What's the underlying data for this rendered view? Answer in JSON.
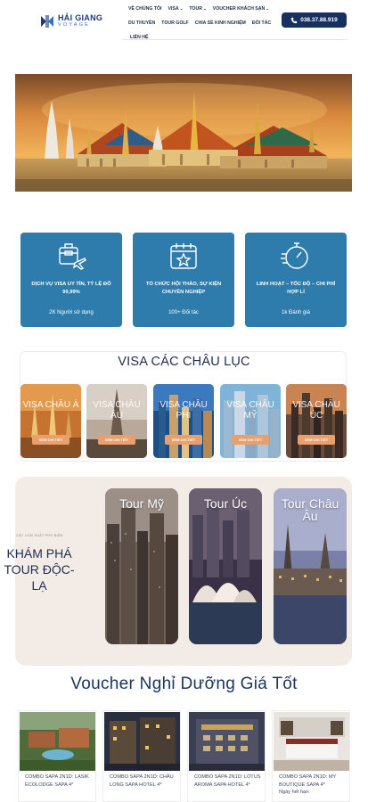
{
  "brand": {
    "name": "HẢI GIANG",
    "sub": "VOYAGE"
  },
  "nav": {
    "row1": [
      {
        "label": "VỀ CHÚNG TÔI",
        "caret": ""
      },
      {
        "label": "VISA",
        "caret": "⌄"
      },
      {
        "label": "TOUR",
        "caret": "⌄"
      },
      {
        "label": "VOUCHER KHÁCH SẠN",
        "caret": "⌄"
      }
    ],
    "row2": [
      {
        "label": "DU THUYỀN"
      },
      {
        "label": "TOUR GOLF"
      },
      {
        "label": "CHIA SẺ KINH NGHIỆM"
      },
      {
        "label": "ĐỐI TÁC"
      }
    ],
    "row3": [
      {
        "label": "LIÊN HỆ"
      }
    ]
  },
  "hotline": {
    "number": "038.37.88.919",
    "icon": "phone-icon"
  },
  "stats": [
    {
      "title": "DỊCH VỤ VISA UY TÍN, TỶ LỆ ĐỖ 99,99%",
      "count": "2K Người sử dụng",
      "icon": "suitcase-plane-icon"
    },
    {
      "title": "TỔ CHỨC HỘI THẢO, SỰ KIỆN CHUYÊN NGHIỆP",
      "count": "100+ Đối tác",
      "icon": "calendar-star-icon"
    },
    {
      "title": "LINH HOẠT – TỐC ĐỘ – CHI PHÍ HỢP LÍ",
      "count": "1k Đánh giá",
      "icon": "stopwatch-icon"
    }
  ],
  "visa": {
    "title": "VISA CÁC CHÂU LỤC",
    "button": "XEM CHI TIẾT",
    "cards": [
      {
        "name": "VISA CHÂU Á"
      },
      {
        "name": "VISA CHÂU ÂU"
      },
      {
        "name": "VISA CHÂU PHI"
      },
      {
        "name": "VISA CHÂU MỸ"
      },
      {
        "name": "VISA CHÂU ÚC"
      }
    ]
  },
  "tour": {
    "kicker": "CÁC LOẠI XUẤT PHỔ BIẾN",
    "heading": "KHÁM PHÁ TOUR ĐỘC-LẠ",
    "cards": [
      {
        "name": "Tour Mỹ"
      },
      {
        "name": "Tour Úc"
      },
      {
        "name": "Tour Châu Âu"
      }
    ]
  },
  "voucher": {
    "title": "Voucher Nghỉ Dưỡng Giá Tốt",
    "cards": [
      {
        "name": "COMBO SAPA 2N1D: LASIK ECOLODGE SAPA 4*",
        "extra": ""
      },
      {
        "name": "COMBO SAPA 2N1D: CHÂU LONG SAPA HOTEL 4*",
        "extra": ""
      },
      {
        "name": "COMBO SAPA 2N1D: LOTUS AROMA SAPA HOTEL 4*",
        "extra": ""
      },
      {
        "name": "COMBO SAPA 2N1D: MY BOUTIQUE SAPA 4*",
        "extra": "Ngày hết hạn:"
      }
    ]
  },
  "colors": {
    "navy": "#16305f",
    "card_blue": "#2d7cab",
    "accent": "#e9a06d",
    "tour_bg": "#f3ece6"
  }
}
